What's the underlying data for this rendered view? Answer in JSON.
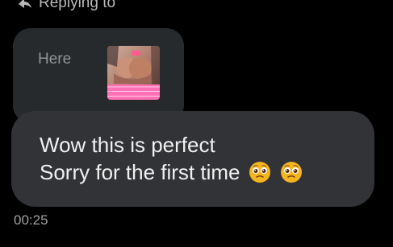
{
  "header": {
    "replying_label": "Replying to",
    "reply_icon": "reply-arrow-icon"
  },
  "quoted_message": {
    "text": "Here",
    "thumbnail_icon": "image-thumbnail"
  },
  "message": {
    "line1": "Wow this is perfect",
    "line2": "Sorry for the first time",
    "emojis": [
      "pleading-face-emoji",
      "pleading-face-emoji"
    ]
  },
  "timestamp": "00:25",
  "colors": {
    "background": "#000000",
    "quoted_bubble": "#272a2d",
    "message_bubble": "#313337",
    "message_text": "#f1f1f1",
    "muted_text": "#a1a1a1",
    "thumbnail_pink": "#ff6fb4",
    "emoji_yellow": "#f4b51f"
  }
}
